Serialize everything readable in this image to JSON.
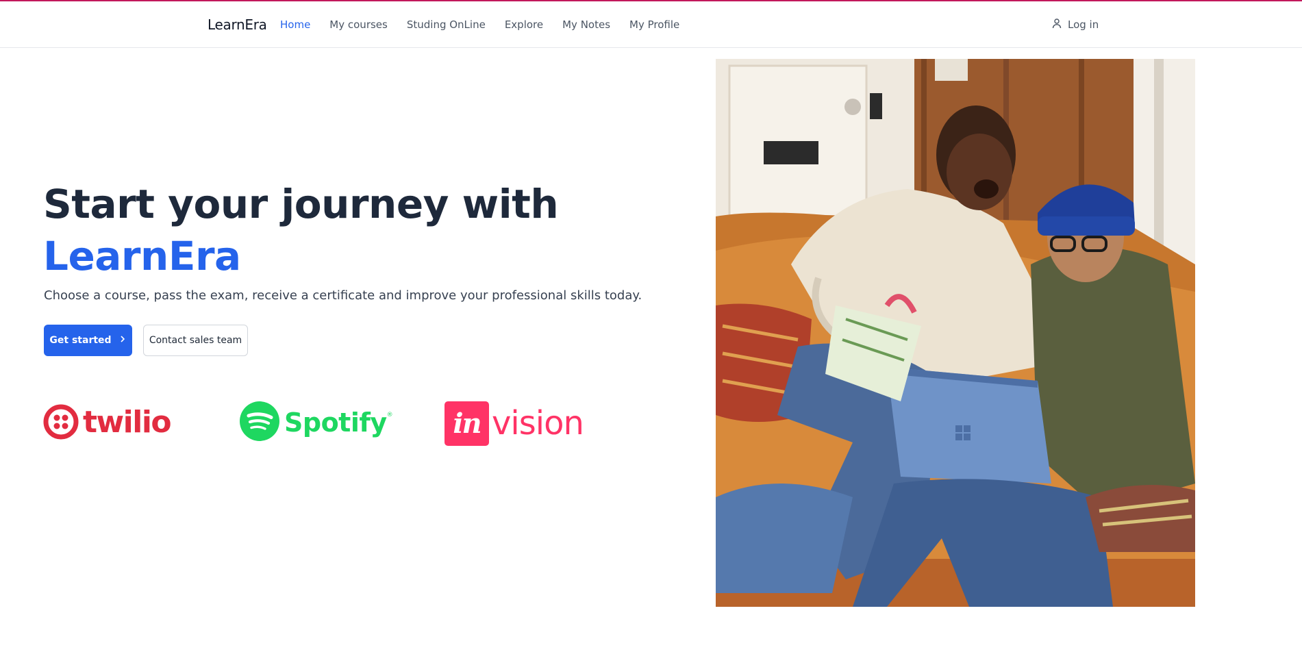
{
  "app": {
    "brand": "LearnEra"
  },
  "nav": {
    "items": [
      {
        "label": "Home",
        "active": true
      },
      {
        "label": "My courses",
        "active": false
      },
      {
        "label": "Studing OnLine",
        "active": false
      },
      {
        "label": "Explore",
        "active": false
      },
      {
        "label": "My Notes",
        "active": false
      },
      {
        "label": "My Profile",
        "active": false
      }
    ],
    "login_label": "Log in",
    "login_icon": "user-icon"
  },
  "hero": {
    "title_line1": "Start your journey with",
    "title_line2": "LearnEra",
    "subtitle": "Choose a course, pass the exam, receive a certificate and improve your professional skills today.",
    "primary_button": "Get started",
    "primary_button_icon": "chevron-right-icon",
    "secondary_button": "Contact sales team"
  },
  "logos": {
    "twilio": "twilio",
    "spotify": "Spotify",
    "spotify_mark": "®",
    "invision_box": "in",
    "invision_text": "vision"
  },
  "colors": {
    "accent": "#2563eb",
    "heading": "#1e293b",
    "twilio": "#e22c40",
    "spotify": "#1ed760",
    "invision": "#ff3366",
    "top_line": "#c2185b"
  }
}
